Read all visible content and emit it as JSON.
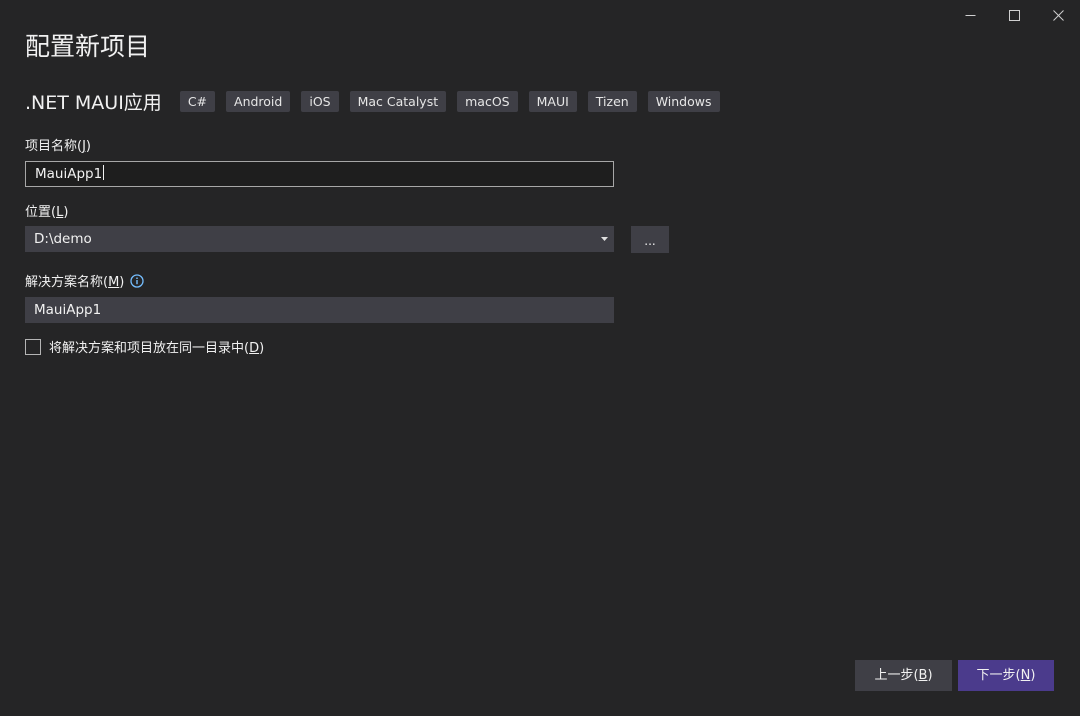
{
  "window": {
    "controls": [
      "minimize",
      "maximize",
      "close"
    ]
  },
  "page": {
    "title": "配置新项目"
  },
  "template": {
    "name": ".NET MAUI应用",
    "tags": [
      "C#",
      "Android",
      "iOS",
      "Mac Catalyst",
      "macOS",
      "MAUI",
      "Tizen",
      "Windows"
    ]
  },
  "project_name": {
    "label": "项目名称(",
    "accel": "J",
    "label_end": ")",
    "value": "MauiApp1"
  },
  "location": {
    "label": "位置(",
    "accel": "L",
    "label_end": ")",
    "value": "D:\\demo",
    "browse_label": "..."
  },
  "solution_name": {
    "label": "解决方案名称(",
    "accel": "M",
    "label_end": ")",
    "value": "MauiApp1"
  },
  "same_directory": {
    "label": "将解决方案和项目放在同一目录中(",
    "accel": "D",
    "label_end": ")",
    "checked": false
  },
  "footer": {
    "back_label": "上一步(",
    "back_accel": "B",
    "back_end": ")",
    "next_label": "下一步(",
    "next_accel": "N",
    "next_end": ")"
  },
  "colors": {
    "background": "#252526",
    "tag_background": "#3f3f46",
    "primary_button": "#4b3b8c",
    "info_icon": "#75beff"
  }
}
